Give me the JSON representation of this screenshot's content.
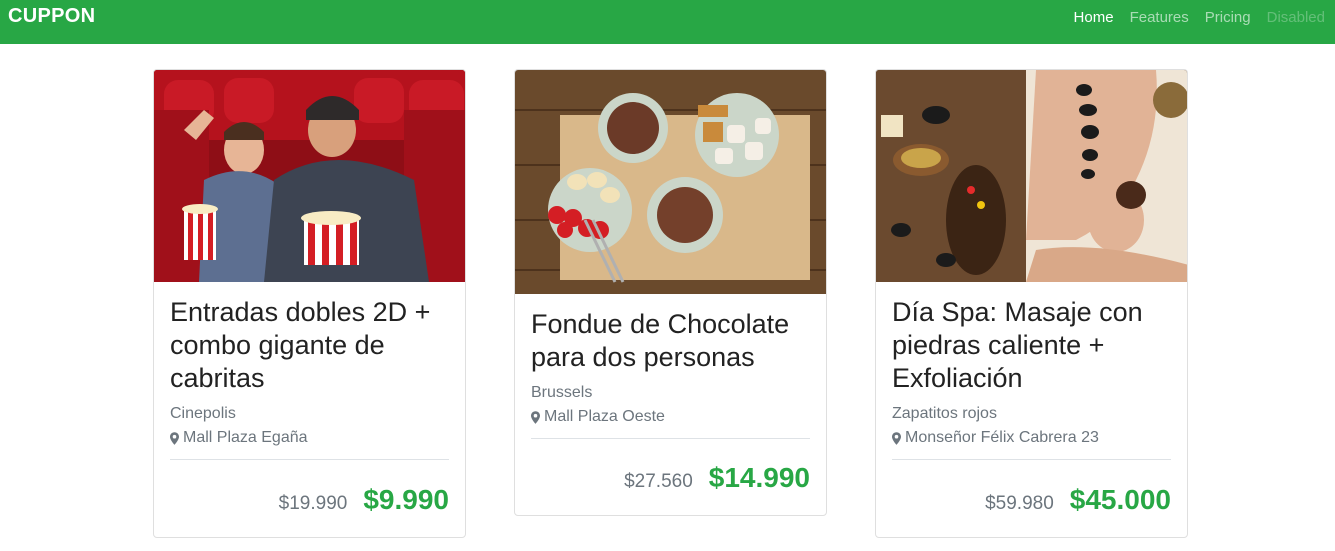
{
  "navbar": {
    "brand": "CUPPON",
    "links": [
      {
        "label": "Home",
        "state": "active"
      },
      {
        "label": "Features",
        "state": "normal"
      },
      {
        "label": "Pricing",
        "state": "normal"
      },
      {
        "label": "Disabled",
        "state": "disabled"
      }
    ],
    "color": "#28a745"
  },
  "deals": [
    {
      "title": "Entradas dobles 2D + combo gigante de cabritas",
      "vendor": "Cinepolis",
      "location": "Mall Plaza Egaña",
      "old_price": "$19.990",
      "new_price": "$9.990",
      "image": "cinema-photo"
    },
    {
      "title": "Fondue de Chocolate para dos personas",
      "vendor": "Brussels",
      "location": "Mall Plaza Oeste",
      "old_price": "$27.560",
      "new_price": "$14.990",
      "image": "chocolate-fondue-photo"
    },
    {
      "title": "Día Spa: Masaje con piedras caliente + Exfoliación",
      "vendor": "Zapatitos rojos",
      "location": "Monseñor Félix Cabrera 23",
      "old_price": "$59.980",
      "new_price": "$45.000",
      "image": "spa-massage-photo"
    }
  ]
}
